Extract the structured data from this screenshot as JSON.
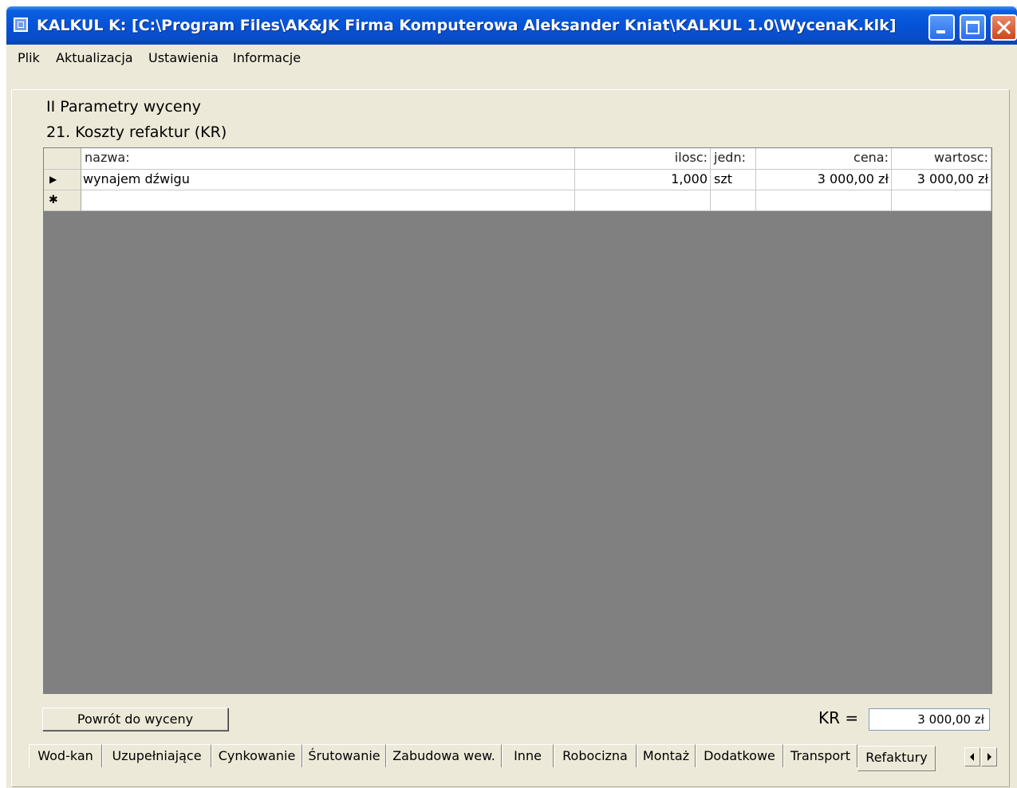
{
  "window": {
    "title": "KALKUL K: [C:\\Program Files\\AK&JK Firma Komputerowa Aleksander Kniat\\KALKUL 1.0\\WycenaK.klk]"
  },
  "menu": {
    "items": [
      "Plik",
      "Aktualizacja",
      "Ustawienia",
      "Informacje"
    ]
  },
  "main": {
    "section_title": "II  Parametry wyceny",
    "subsection_title": "21. Koszty refaktur (KR)"
  },
  "grid": {
    "columns": [
      "nazwa:",
      "ilosc:",
      "jedn:",
      "cena:",
      "wartosc:"
    ],
    "rows": [
      {
        "marker": "▶",
        "nazwa": "wynajem dźwigu",
        "ilosc": "1,000",
        "jedn": "szt",
        "cena": "3 000,00 zł",
        "wartosc": "3 000,00 zł"
      }
    ],
    "new_row_marker": "✱"
  },
  "footer": {
    "back_button": "Powrót do wyceny",
    "kr_label": "KR =",
    "kr_value": "3 000,00 zł"
  },
  "tabs": [
    "Wod-kan",
    "Uzupełniające",
    "Cynkowanie",
    "Śrutowanie",
    "Zabudowa wew.",
    "Inne",
    "Robocizna",
    "Montaż",
    "Dodatkowe",
    "Transport",
    "Refaktury"
  ],
  "active_tab": "Refaktury",
  "colors": {
    "title_bar": "#0552d6",
    "window_face": "#ece9d8",
    "grid_empty": "#808080",
    "close_button": "#d0451b"
  }
}
